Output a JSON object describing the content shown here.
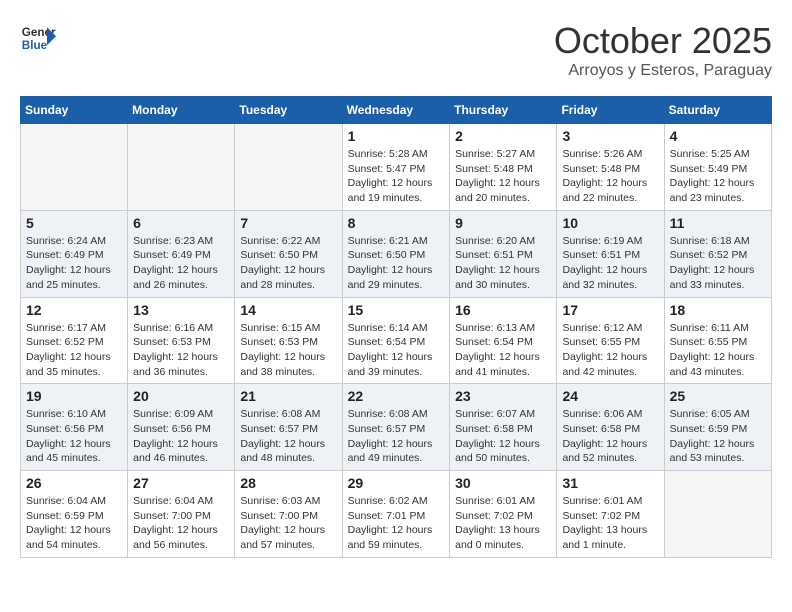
{
  "header": {
    "logo_line1": "General",
    "logo_line2": "Blue",
    "month_title": "October 2025",
    "location": "Arroyos y Esteros, Paraguay"
  },
  "days_of_week": [
    "Sunday",
    "Monday",
    "Tuesday",
    "Wednesday",
    "Thursday",
    "Friday",
    "Saturday"
  ],
  "weeks": [
    [
      {
        "day": "",
        "info": ""
      },
      {
        "day": "",
        "info": ""
      },
      {
        "day": "",
        "info": ""
      },
      {
        "day": "1",
        "info": "Sunrise: 5:28 AM\nSunset: 5:47 PM\nDaylight: 12 hours\nand 19 minutes."
      },
      {
        "day": "2",
        "info": "Sunrise: 5:27 AM\nSunset: 5:48 PM\nDaylight: 12 hours\nand 20 minutes."
      },
      {
        "day": "3",
        "info": "Sunrise: 5:26 AM\nSunset: 5:48 PM\nDaylight: 12 hours\nand 22 minutes."
      },
      {
        "day": "4",
        "info": "Sunrise: 5:25 AM\nSunset: 5:49 PM\nDaylight: 12 hours\nand 23 minutes."
      }
    ],
    [
      {
        "day": "5",
        "info": "Sunrise: 6:24 AM\nSunset: 6:49 PM\nDaylight: 12 hours\nand 25 minutes."
      },
      {
        "day": "6",
        "info": "Sunrise: 6:23 AM\nSunset: 6:49 PM\nDaylight: 12 hours\nand 26 minutes."
      },
      {
        "day": "7",
        "info": "Sunrise: 6:22 AM\nSunset: 6:50 PM\nDaylight: 12 hours\nand 28 minutes."
      },
      {
        "day": "8",
        "info": "Sunrise: 6:21 AM\nSunset: 6:50 PM\nDaylight: 12 hours\nand 29 minutes."
      },
      {
        "day": "9",
        "info": "Sunrise: 6:20 AM\nSunset: 6:51 PM\nDaylight: 12 hours\nand 30 minutes."
      },
      {
        "day": "10",
        "info": "Sunrise: 6:19 AM\nSunset: 6:51 PM\nDaylight: 12 hours\nand 32 minutes."
      },
      {
        "day": "11",
        "info": "Sunrise: 6:18 AM\nSunset: 6:52 PM\nDaylight: 12 hours\nand 33 minutes."
      }
    ],
    [
      {
        "day": "12",
        "info": "Sunrise: 6:17 AM\nSunset: 6:52 PM\nDaylight: 12 hours\nand 35 minutes."
      },
      {
        "day": "13",
        "info": "Sunrise: 6:16 AM\nSunset: 6:53 PM\nDaylight: 12 hours\nand 36 minutes."
      },
      {
        "day": "14",
        "info": "Sunrise: 6:15 AM\nSunset: 6:53 PM\nDaylight: 12 hours\nand 38 minutes."
      },
      {
        "day": "15",
        "info": "Sunrise: 6:14 AM\nSunset: 6:54 PM\nDaylight: 12 hours\nand 39 minutes."
      },
      {
        "day": "16",
        "info": "Sunrise: 6:13 AM\nSunset: 6:54 PM\nDaylight: 12 hours\nand 41 minutes."
      },
      {
        "day": "17",
        "info": "Sunrise: 6:12 AM\nSunset: 6:55 PM\nDaylight: 12 hours\nand 42 minutes."
      },
      {
        "day": "18",
        "info": "Sunrise: 6:11 AM\nSunset: 6:55 PM\nDaylight: 12 hours\nand 43 minutes."
      }
    ],
    [
      {
        "day": "19",
        "info": "Sunrise: 6:10 AM\nSunset: 6:56 PM\nDaylight: 12 hours\nand 45 minutes."
      },
      {
        "day": "20",
        "info": "Sunrise: 6:09 AM\nSunset: 6:56 PM\nDaylight: 12 hours\nand 46 minutes."
      },
      {
        "day": "21",
        "info": "Sunrise: 6:08 AM\nSunset: 6:57 PM\nDaylight: 12 hours\nand 48 minutes."
      },
      {
        "day": "22",
        "info": "Sunrise: 6:08 AM\nSunset: 6:57 PM\nDaylight: 12 hours\nand 49 minutes."
      },
      {
        "day": "23",
        "info": "Sunrise: 6:07 AM\nSunset: 6:58 PM\nDaylight: 12 hours\nand 50 minutes."
      },
      {
        "day": "24",
        "info": "Sunrise: 6:06 AM\nSunset: 6:58 PM\nDaylight: 12 hours\nand 52 minutes."
      },
      {
        "day": "25",
        "info": "Sunrise: 6:05 AM\nSunset: 6:59 PM\nDaylight: 12 hours\nand 53 minutes."
      }
    ],
    [
      {
        "day": "26",
        "info": "Sunrise: 6:04 AM\nSunset: 6:59 PM\nDaylight: 12 hours\nand 54 minutes."
      },
      {
        "day": "27",
        "info": "Sunrise: 6:04 AM\nSunset: 7:00 PM\nDaylight: 12 hours\nand 56 minutes."
      },
      {
        "day": "28",
        "info": "Sunrise: 6:03 AM\nSunset: 7:00 PM\nDaylight: 12 hours\nand 57 minutes."
      },
      {
        "day": "29",
        "info": "Sunrise: 6:02 AM\nSunset: 7:01 PM\nDaylight: 12 hours\nand 59 minutes."
      },
      {
        "day": "30",
        "info": "Sunrise: 6:01 AM\nSunset: 7:02 PM\nDaylight: 13 hours\nand 0 minutes."
      },
      {
        "day": "31",
        "info": "Sunrise: 6:01 AM\nSunset: 7:02 PM\nDaylight: 13 hours\nand 1 minute."
      },
      {
        "day": "",
        "info": ""
      }
    ]
  ]
}
